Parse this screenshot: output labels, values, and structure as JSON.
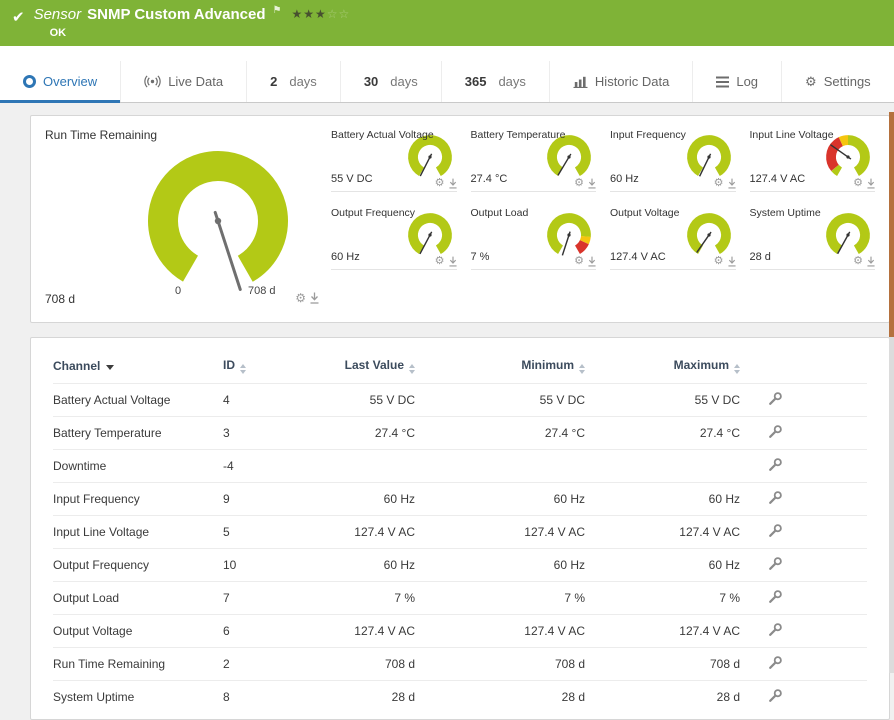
{
  "colors": {
    "ok_green": "#7fb337",
    "gauge_green": "#b3c916",
    "alert_red": "#d9342b",
    "warn_yellow": "#f5c50e",
    "accent_blue": "#2e76b5"
  },
  "header": {
    "check": "✔",
    "title_prefix": "Sensor",
    "title": "SNMP Custom Advanced",
    "flag": "⚑",
    "stars_filled": "★★★",
    "stars_empty": "☆☆",
    "status": "OK"
  },
  "tabs": [
    {
      "label": "Overview"
    },
    {
      "label": "Live Data"
    },
    {
      "num": "2",
      "word": "days"
    },
    {
      "num": "30",
      "word": "days"
    },
    {
      "num": "365",
      "word": "days"
    },
    {
      "label": "Historic Data"
    },
    {
      "label": "Log"
    },
    {
      "label": "Settings"
    }
  ],
  "gauges": {
    "main": {
      "label": "Run Time Remaining",
      "value": "708 d",
      "scale_min": "0",
      "scale_max": "708 d"
    },
    "small": [
      {
        "label": "Battery Actual Voltage",
        "value": "55 V DC"
      },
      {
        "label": "Battery Temperature",
        "value": "27.4 °C"
      },
      {
        "label": "Input Frequency",
        "value": "60 Hz"
      },
      {
        "label": "Input Line Voltage",
        "value": "127.4 V AC"
      },
      {
        "label": "Output Frequency",
        "value": "60 Hz"
      },
      {
        "label": "Output Load",
        "value": "7 %"
      },
      {
        "label": "Output Voltage",
        "value": "127.4 V AC"
      },
      {
        "label": "System Uptime",
        "value": "28 d"
      }
    ]
  },
  "table": {
    "headers": {
      "channel": "Channel",
      "id": "ID",
      "last": "Last Value",
      "min": "Minimum",
      "max": "Maximum"
    },
    "rows": [
      {
        "channel": "Battery Actual Voltage",
        "id": "4",
        "last": "55 V DC",
        "min": "55 V DC",
        "max": "55 V DC"
      },
      {
        "channel": "Battery Temperature",
        "id": "3",
        "last": "27.4 °C",
        "min": "27.4 °C",
        "max": "27.4 °C"
      },
      {
        "channel": "Downtime",
        "id": "-4",
        "last": "",
        "min": "",
        "max": ""
      },
      {
        "channel": "Input Frequency",
        "id": "9",
        "last": "60 Hz",
        "min": "60 Hz",
        "max": "60 Hz"
      },
      {
        "channel": "Input Line Voltage",
        "id": "5",
        "last": "127.4 V AC",
        "min": "127.4 V AC",
        "max": "127.4 V AC"
      },
      {
        "channel": "Output Frequency",
        "id": "10",
        "last": "60 Hz",
        "min": "60 Hz",
        "max": "60 Hz"
      },
      {
        "channel": "Output Load",
        "id": "7",
        "last": "7 %",
        "min": "7 %",
        "max": "7 %"
      },
      {
        "channel": "Output Voltage",
        "id": "6",
        "last": "127.4 V AC",
        "min": "127.4 V AC",
        "max": "127.4 V AC"
      },
      {
        "channel": "Run Time Remaining",
        "id": "2",
        "last": "708 d",
        "min": "708 d",
        "max": "708 d"
      },
      {
        "channel": "System Uptime",
        "id": "8",
        "last": "28 d",
        "min": "28 d",
        "max": "28 d"
      }
    ]
  }
}
